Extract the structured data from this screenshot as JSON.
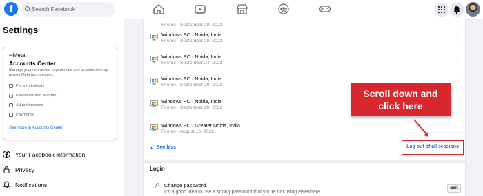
{
  "topbar": {
    "logo": "f",
    "search_placeholder": "Search Facebook",
    "nav_icons": [
      "home-icon",
      "watch-icon",
      "marketplace-icon",
      "groups-icon",
      "gaming-icon"
    ],
    "right_icons": [
      "menu-grid-icon",
      "notifications-icon",
      "avatar"
    ]
  },
  "sidebar": {
    "title": "Settings",
    "accounts_center": {
      "brand": "Meta",
      "title": "Accounts Center",
      "description": "Manage your connected experiences and account settings across Meta technologies.",
      "items": [
        "Personal details",
        "Password and security",
        "Ad preferences",
        "Payments"
      ],
      "more_link": "See more in Accounts Center"
    },
    "items": [
      {
        "label": "Your Facebook information",
        "icon": "facebook-icon"
      },
      {
        "label": "Privacy",
        "icon": "lock-icon"
      },
      {
        "label": "Notifications",
        "icon": "bell-icon"
      }
    ]
  },
  "sessions": [
    {
      "device": "",
      "detail": "Firefox · September 28, 2022"
    },
    {
      "device": "Windows PC · Noida, India",
      "detail": "Firefox · September 28, 2022"
    },
    {
      "device": "Windows PC · Noida, India",
      "detail": "Firefox · September 24, 2022"
    },
    {
      "device": "Windows PC · Noida, India",
      "detail": "Firefox · September 20, 2022"
    },
    {
      "device": "Windows PC · Noida, India",
      "detail": "Firefox · September 20, 2022"
    },
    {
      "device": "Windows PC · Greater Noida, India",
      "detail": "Firefox · August 15, 2022"
    }
  ],
  "see_less": "See less",
  "logout_all": "Log out of all sessions",
  "login": {
    "heading": "Login",
    "change_password_title": "Change password",
    "change_password_desc": "It's a good idea to use a strong password that you're not using elsewhere",
    "edit_label": "Edit"
  },
  "callout": {
    "line1": "Scroll down and",
    "line2": "click here"
  },
  "colors": {
    "brand_blue": "#1877f2",
    "link_blue": "#216fdb",
    "callout_red": "#d9272e"
  }
}
